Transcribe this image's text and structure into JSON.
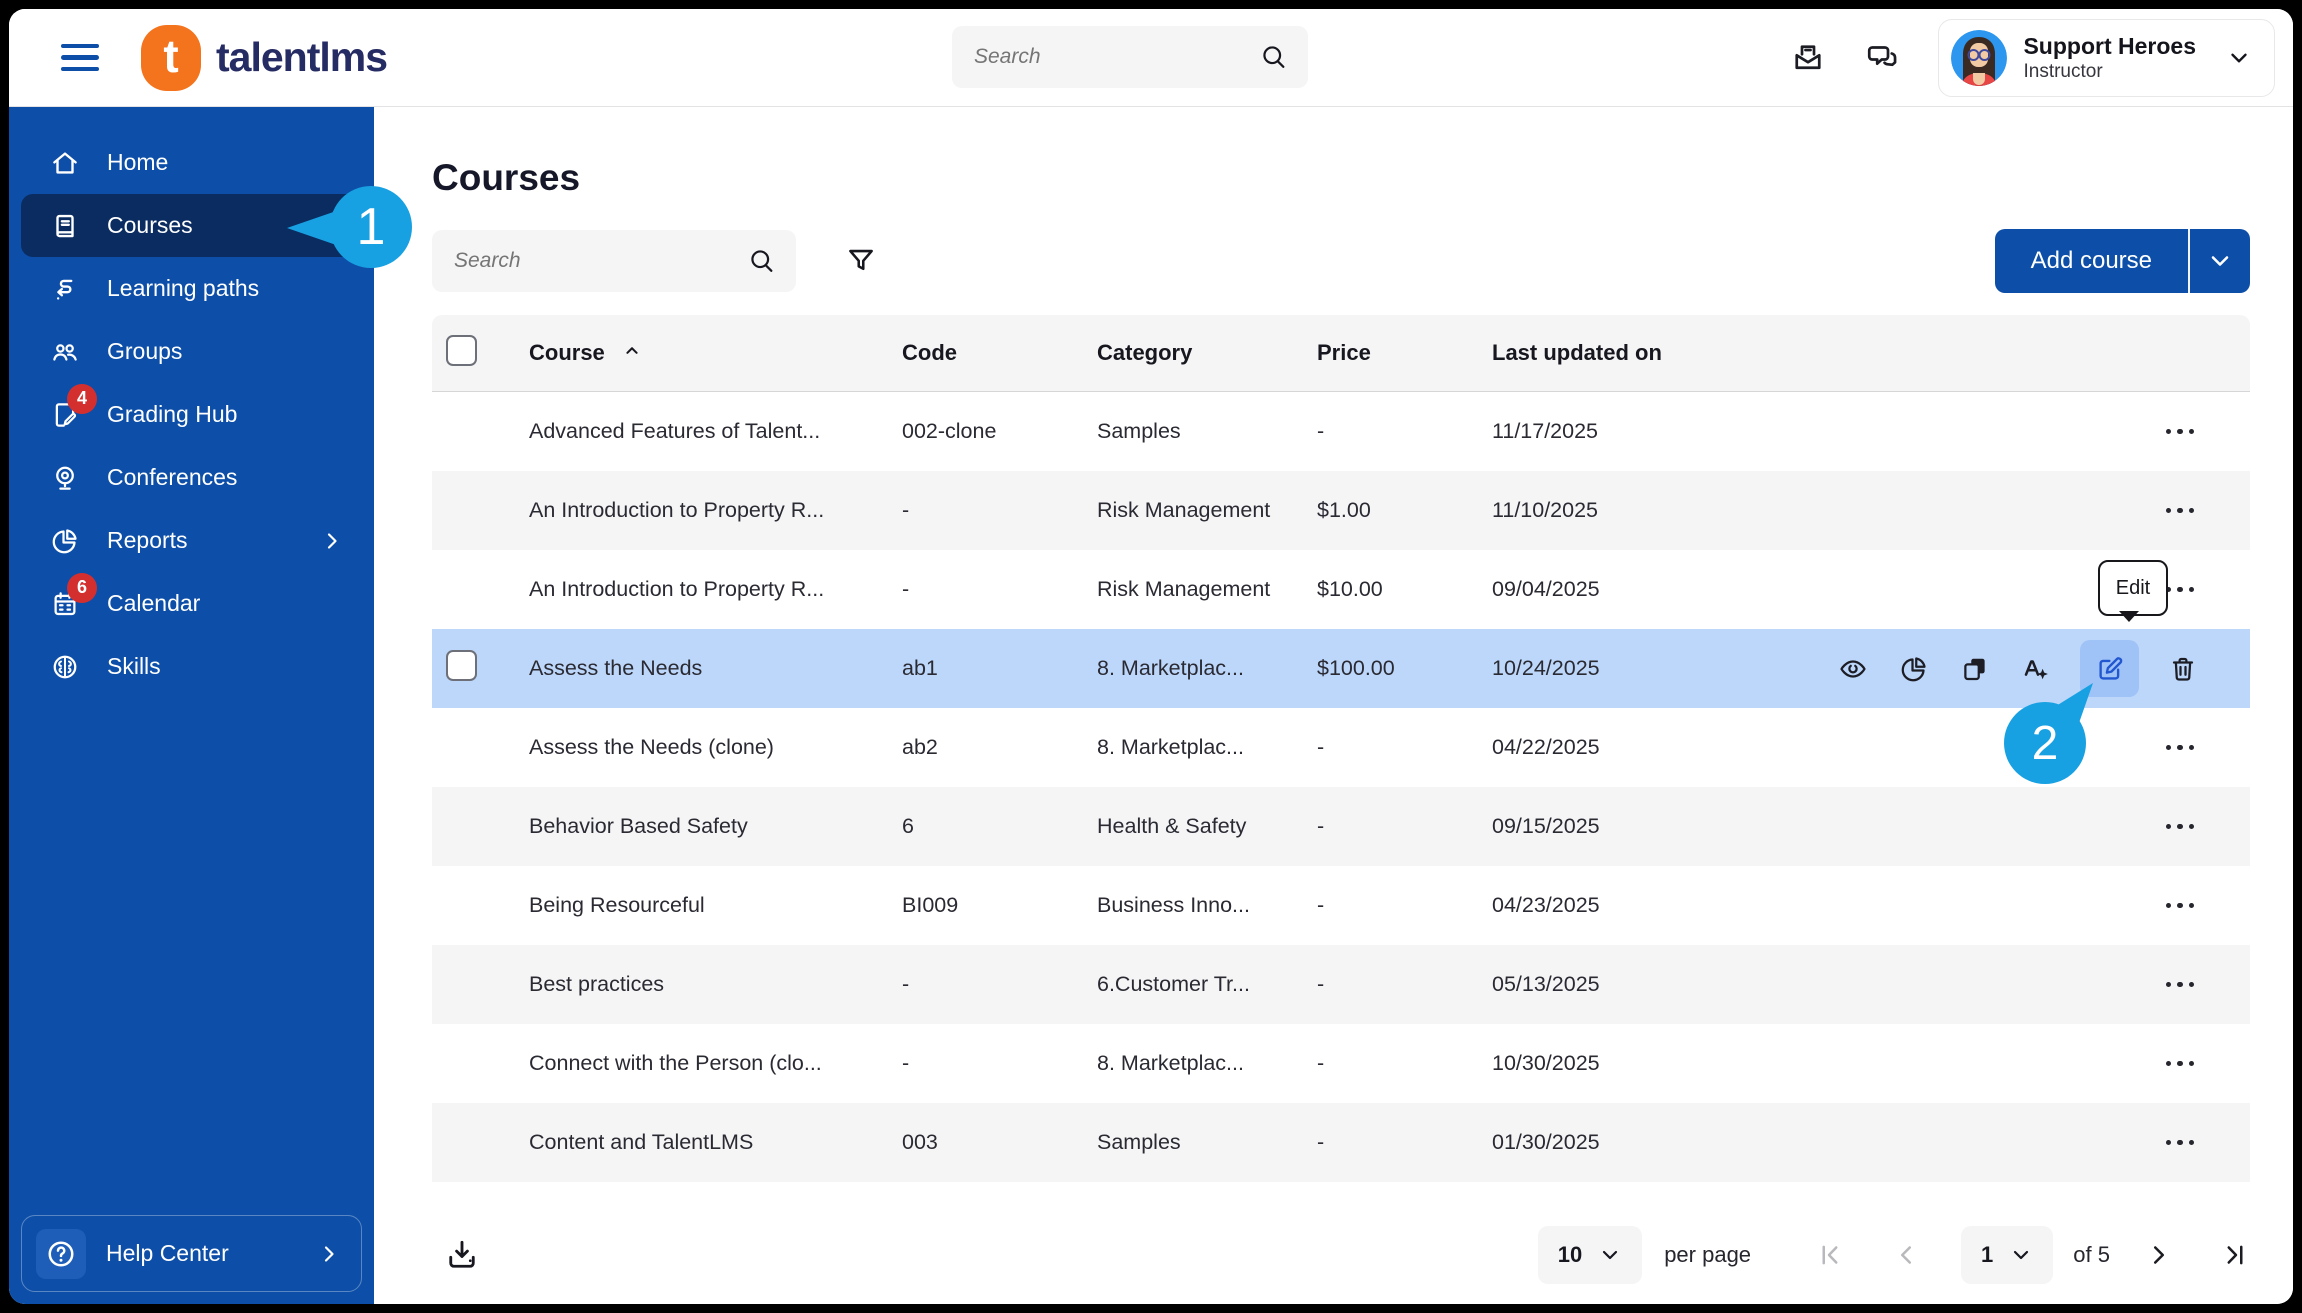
{
  "brand": {
    "logo_letter": "t",
    "wordmark": "talentlms"
  },
  "topbar": {
    "search_placeholder": "Search",
    "icons": [
      "inbox-icon",
      "discussions-icon"
    ],
    "user": {
      "name": "Support Heroes",
      "role": "Instructor"
    }
  },
  "sidebar": {
    "items": [
      {
        "label": "Home",
        "icon": "i-home"
      },
      {
        "label": "Courses",
        "icon": "i-book",
        "selected": true
      },
      {
        "label": "Learning paths",
        "icon": "i-path"
      },
      {
        "label": "Groups",
        "icon": "i-groups"
      },
      {
        "label": "Grading Hub",
        "icon": "i-grading",
        "badge": "4"
      },
      {
        "label": "Conferences",
        "icon": "i-webcam"
      },
      {
        "label": "Reports",
        "icon": "i-pie",
        "chevron": true
      },
      {
        "label": "Calendar",
        "icon": "i-calendar",
        "badge": "6"
      },
      {
        "label": "Skills",
        "icon": "i-brain"
      }
    ],
    "help_label": "Help Center"
  },
  "page": {
    "title": "Courses",
    "search_placeholder": "Search",
    "add_course_label": "Add course"
  },
  "table": {
    "columns": [
      "Course",
      "Code",
      "Category",
      "Price",
      "Last updated on"
    ],
    "sorted_column": "Course",
    "sort_direction": "asc",
    "rows": [
      {
        "course": "Advanced Features of Talent...",
        "code": "002-clone",
        "category": "Samples",
        "price": "-",
        "updated": "11/17/2025"
      },
      {
        "course": "An Introduction to Property R...",
        "code": "-",
        "category": "Risk Management",
        "price": "$1.00",
        "updated": "11/10/2025"
      },
      {
        "course": "An Introduction to Property R...",
        "code": "-",
        "category": "Risk Management",
        "price": "$10.00",
        "updated": "09/04/2025"
      },
      {
        "course": "Assess the Needs",
        "code": "ab1",
        "category": "8. Marketplac...",
        "price": "$100.00",
        "updated": "10/24/2025",
        "selected": true
      },
      {
        "course": "Assess the Needs (clone)",
        "code": "ab2",
        "category": "8. Marketplac...",
        "price": "-",
        "updated": "04/22/2025"
      },
      {
        "course": "Behavior Based Safety",
        "code": "6",
        "category": "Health & Safety",
        "price": "-",
        "updated": "09/15/2025"
      },
      {
        "course": "Being Resourceful",
        "code": "BI009",
        "category": "Business Inno...",
        "price": "-",
        "updated": "04/23/2025"
      },
      {
        "course": "Best practices",
        "code": "-",
        "category": "6.Customer Tr...",
        "price": "-",
        "updated": "05/13/2025"
      },
      {
        "course": "Connect with the Person (clo...",
        "code": "-",
        "category": "8. Marketplac...",
        "price": "-",
        "updated": "10/30/2025"
      },
      {
        "course": "Content and TalentLMS",
        "code": "003",
        "category": "Samples",
        "price": "-",
        "updated": "01/30/2025"
      }
    ]
  },
  "row_actions": {
    "tooltip": "Edit",
    "icons": [
      "preview-eye-icon",
      "reports-pie-icon",
      "clone-copy-icon",
      "translate-icon",
      "edit-icon",
      "delete-trash-icon"
    ]
  },
  "callouts": {
    "step1": "1",
    "step2": "2"
  },
  "pagination": {
    "per_page": "10",
    "per_page_label": "per page",
    "page": "1",
    "of_label": "of 5"
  },
  "colors": {
    "primary_blue": "#0d4fa8",
    "sidebar_selected": "#0a2c61",
    "callout_blue": "#18a1e2",
    "selected_row": "#bdd7fa",
    "edit_highlight": "#9fc3f7",
    "badge_red": "#d32f2f",
    "brand_orange": "#f4731d",
    "wordmark_navy": "#252b63"
  }
}
